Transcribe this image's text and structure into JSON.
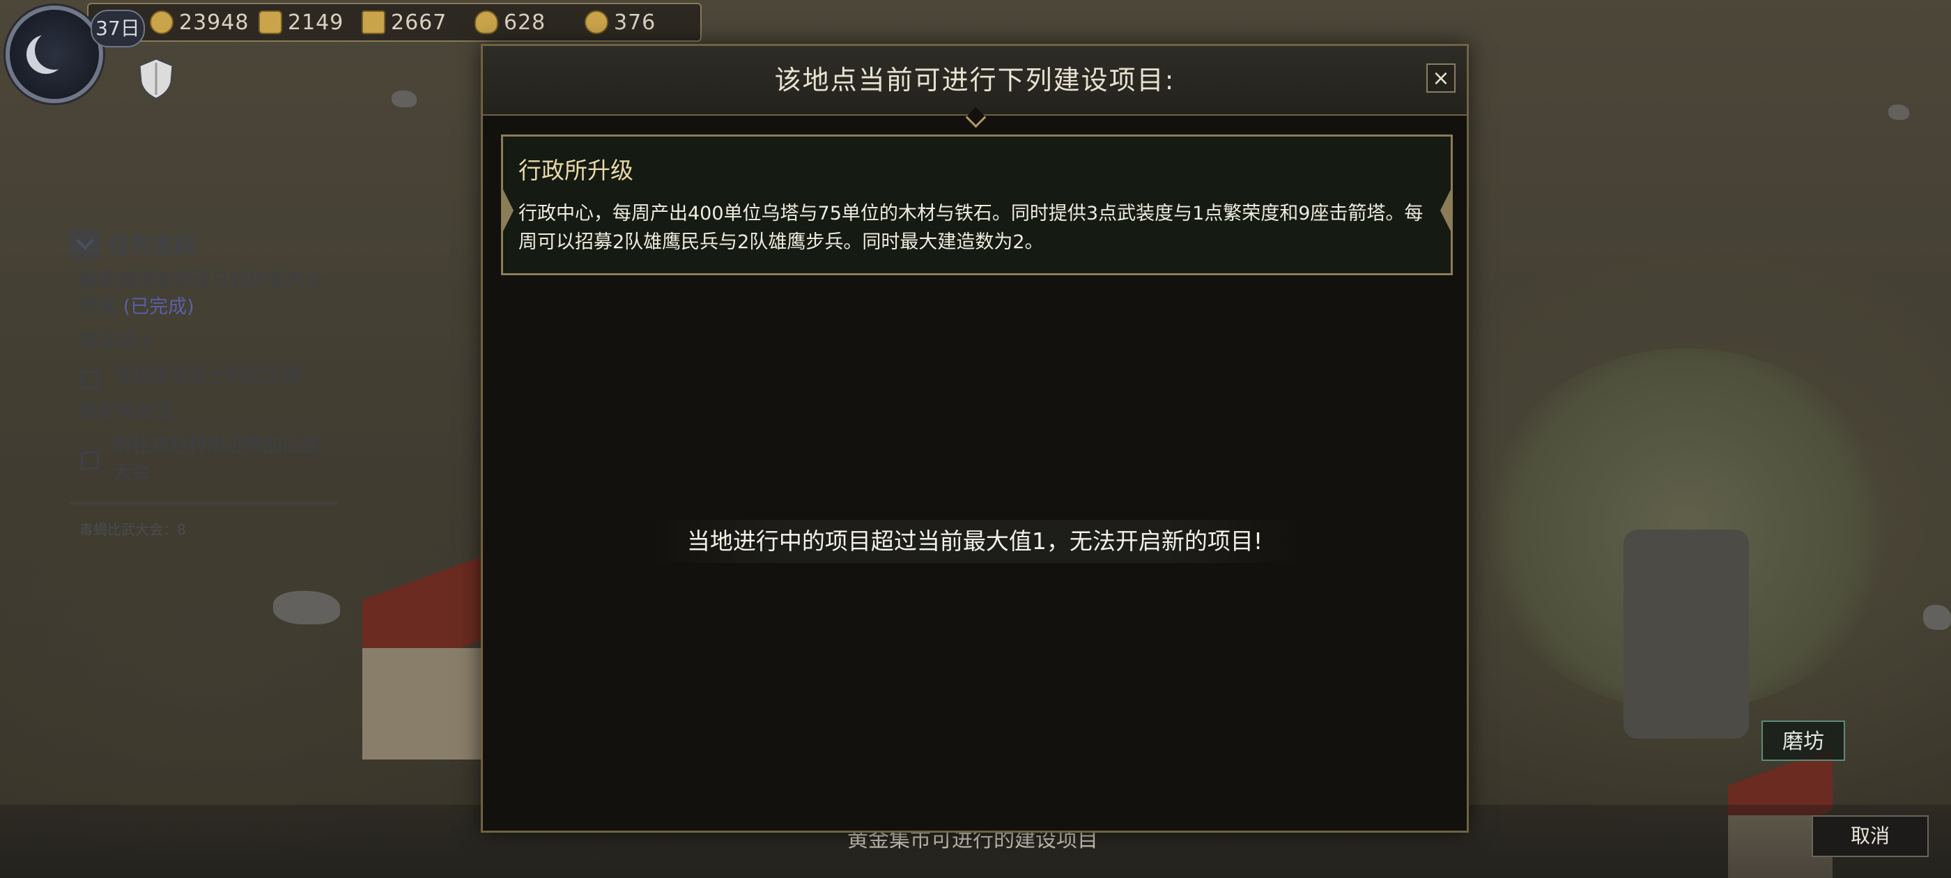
{
  "hud": {
    "day": "37日",
    "resources": [
      {
        "icon": "gold-coin-icon",
        "value": "23948"
      },
      {
        "icon": "wood-log-icon",
        "value": "2149"
      },
      {
        "icon": "iron-ingot-icon",
        "value": "2667"
      },
      {
        "icon": "grain-sack-icon",
        "value": "628"
      },
      {
        "icon": "horn-icon",
        "value": "376"
      }
    ]
  },
  "quest_tracker": {
    "title": "任务追踪",
    "quests": [
      {
        "text": "解救被绑架到驿马村的花卉乡贵族",
        "status": "(已完成)"
      },
      {
        "text": "将军骑士",
        "objective": "寻找将军骑士的纪念碑"
      },
      {
        "text": "骆驼城秘宝",
        "objective": "前往双柱村附近参加比武大会"
      }
    ],
    "note": "毒蝎比武大会：8"
  },
  "dialog": {
    "title": "该地点当前可进行下列建设项目:",
    "close_label": "×",
    "project": {
      "name": "行政所升级",
      "description": "行政中心，每周产出400单位乌塔与75单位的木材与铁石。同时提供3点武装度与1点繁荣度和9座击箭塔。每周可以招募2队雄鹰民兵与2队雄鹰步兵。同时最大建造数为2。"
    },
    "warning": "当地进行中的项目超过当前最大值1，无法开启新的项目!"
  },
  "map": {
    "building_label": "磨坊",
    "background_caption": "黄金集市可进行的建设项目"
  },
  "footer": {
    "cancel_label": "取消"
  },
  "colors": {
    "dialog_bg": "#12110d",
    "border_gold": "#8a7d58",
    "project_title": "#e9d9a8",
    "quest_done": "#5a5fa8"
  }
}
